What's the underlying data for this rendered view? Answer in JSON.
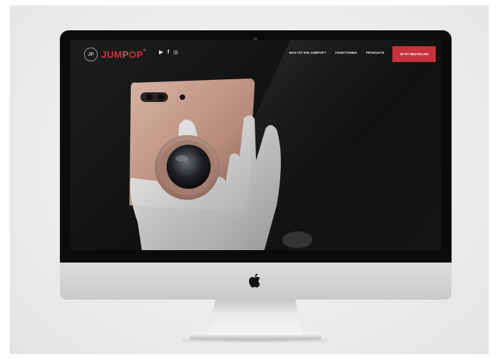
{
  "brand": {
    "badge": "JP",
    "name_part1": "JUM",
    "name_part2": "P",
    "name_part3": "OP",
    "trademark": "®"
  },
  "social": {
    "youtube": "▶",
    "facebook": "f",
    "instagram": "◎"
  },
  "nav": {
    "items": [
      "WAS IST EIN JUMPOP?",
      "FUNKTIONEN",
      "PRODUKTE"
    ],
    "cta": "JETZT BESTELLEN"
  },
  "colors": {
    "accent": "#c8323c",
    "screen_bg": "#111313",
    "phone": "#c9a193",
    "hand": "#e8e8e8"
  },
  "icons": {
    "youtube": "youtube-icon",
    "facebook": "facebook-icon",
    "instagram": "instagram-icon",
    "apple": "apple-logo-icon"
  }
}
